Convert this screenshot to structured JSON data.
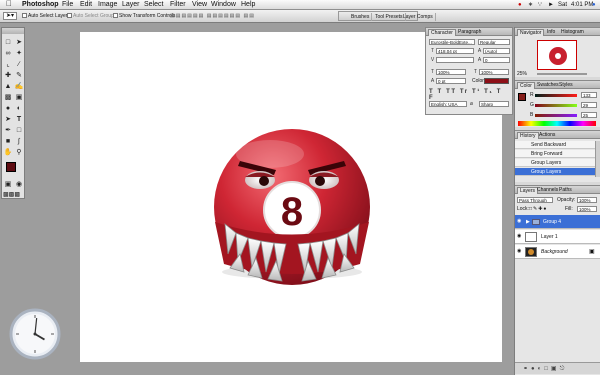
{
  "menubar": {
    "app": "Photoshop",
    "items": [
      "File",
      "Edit",
      "Image",
      "Layer",
      "Select",
      "Filter",
      "View",
      "Window",
      "Help"
    ],
    "right": {
      "status": "4:01 PM",
      "extras": "Sat"
    }
  },
  "options_bar": {
    "auto_select": "Auto Select Layer",
    "auto_select_groups": "Auto Select Groups",
    "transform": "Show Transform Controls"
  },
  "palette_well": {
    "tabs": [
      "Brushes",
      "Tool Presets",
      "Layer Comps"
    ]
  },
  "character_panel": {
    "tabs": [
      "Character",
      "Paragraph"
    ],
    "font_family": "Eurostile-BoldExte...",
    "font_style": "Regular",
    "size": "418.04 pt",
    "leading": "(Auto)",
    "tracking_val": "0",
    "vertical_scale": "100%",
    "horizontal_scale": "100%",
    "baseline": "0 pt",
    "color_label": "Color:",
    "color": "#8d0f17",
    "language": "English: USA",
    "aa_label": "a",
    "anti_alias": "Sharp"
  },
  "navigator_panel": {
    "tabs": [
      "Navigator",
      "Info",
      "Histogram"
    ],
    "zoom": "25%"
  },
  "color_panel": {
    "tabs": [
      "Color",
      "Swatches",
      "Styles"
    ],
    "r_label": "R",
    "r_value": "133",
    "g_label": "G",
    "g_value": "29",
    "b_label": "B",
    "b_value": "25",
    "fg_color": "#851d19"
  },
  "history_panel": {
    "tabs": [
      "History",
      "Actions"
    ],
    "items": [
      {
        "label": "Send Backward",
        "selected": false
      },
      {
        "label": "Bring Forward",
        "selected": false
      },
      {
        "label": "Group Layers",
        "selected": false
      },
      {
        "label": "Group Layers",
        "selected": true
      }
    ]
  },
  "layers_panel": {
    "tabs": [
      "Layers",
      "Channels",
      "Paths"
    ],
    "blend_mode": "Pass Through",
    "opacity_label": "Opacity:",
    "opacity": "100%",
    "lock_label": "Lock:",
    "fill_label": "Fill:",
    "fill": "100%",
    "layers": [
      {
        "name": "Group 4",
        "selected": true,
        "type": "group"
      },
      {
        "name": "Layer 1",
        "selected": false,
        "type": "layer"
      },
      {
        "name": "Background",
        "selected": false,
        "type": "background"
      }
    ]
  },
  "artwork": {
    "ball_number": "8",
    "ball_color": "#c8202e"
  },
  "clock": {
    "hour": 4,
    "minute": 1
  }
}
